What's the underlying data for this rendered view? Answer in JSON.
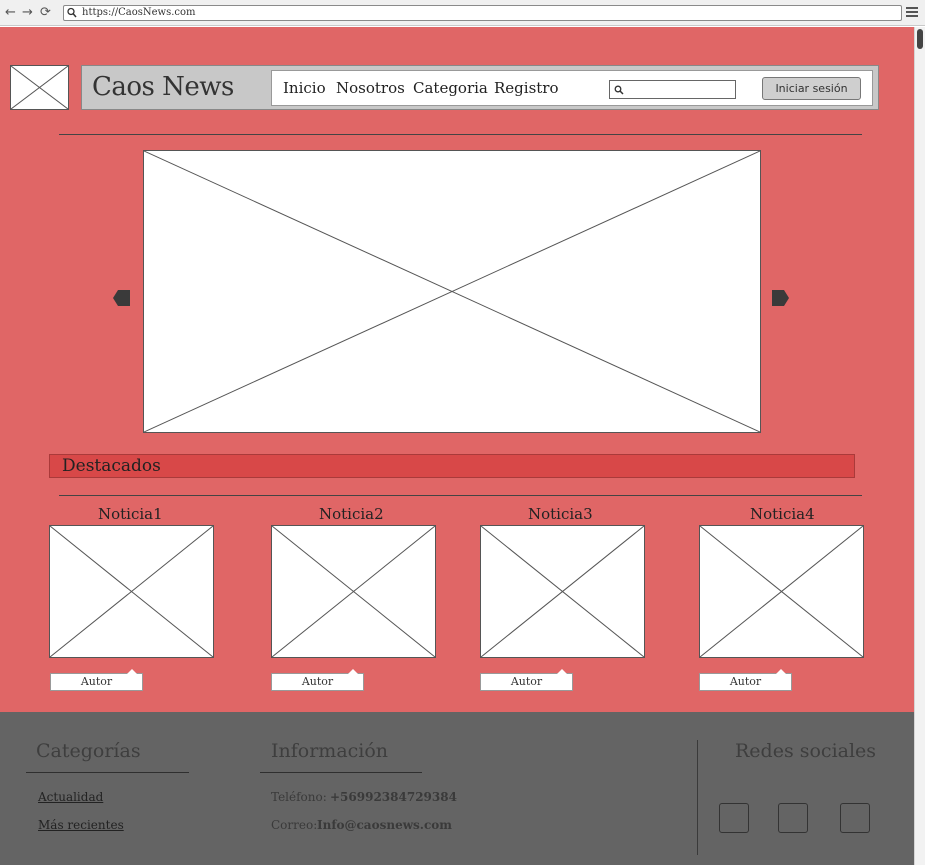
{
  "browser": {
    "url": "https://CaosNews.com",
    "back_glyph": "←",
    "forward_glyph": "→",
    "reload_glyph": "⟳"
  },
  "header": {
    "site_title": "Caos News",
    "nav": [
      "Inicio",
      "Nosotros",
      "Categoria",
      "Registro"
    ],
    "search_placeholder": "",
    "login_label": "Iniciar sesión"
  },
  "featured_section": {
    "label": "Destacados"
  },
  "news": [
    {
      "title": "Noticia1",
      "author": "Autor"
    },
    {
      "title": "Noticia2",
      "author": "Autor"
    },
    {
      "title": "Noticia3",
      "author": "Autor"
    },
    {
      "title": "Noticia4",
      "author": "Autor"
    }
  ],
  "footer": {
    "categories": {
      "heading": "Categorías",
      "links": [
        "Actualidad",
        "Más recientes"
      ]
    },
    "info": {
      "heading": "Información",
      "phone_label": "Teléfono:",
      "phone_value": "+56992384729384",
      "email_label": "Correo:",
      "email_value": "Info@caosnews.com"
    },
    "social": {
      "heading": "Redes sociales"
    }
  },
  "colors": {
    "page_bg": "#e06666",
    "featured_bar": "#d84848",
    "footer_bg": "#646464"
  }
}
